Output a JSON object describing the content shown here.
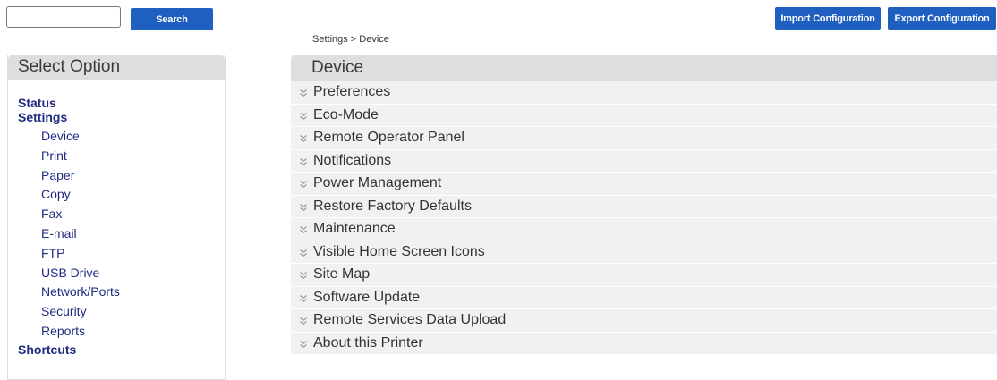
{
  "search": {
    "value": "",
    "placeholder": "",
    "button_label": "Search"
  },
  "header_actions": {
    "import_label": "Import Configuration",
    "export_label": "Export Configuration"
  },
  "breadcrumb": "Settings > Device",
  "sidebar": {
    "title": "Select Option",
    "status_label": "Status",
    "settings_label": "Settings",
    "settings_items": [
      {
        "label": "Device"
      },
      {
        "label": "Print"
      },
      {
        "label": "Paper"
      },
      {
        "label": "Copy"
      },
      {
        "label": "Fax"
      },
      {
        "label": "E-mail"
      },
      {
        "label": "FTP"
      },
      {
        "label": "USB Drive"
      },
      {
        "label": "Network/Ports"
      },
      {
        "label": "Security"
      },
      {
        "label": "Reports"
      }
    ],
    "shortcuts_label": "Shortcuts"
  },
  "main": {
    "title": "Device",
    "sections": [
      {
        "label": "Preferences"
      },
      {
        "label": "Eco-Mode"
      },
      {
        "label": "Remote Operator Panel"
      },
      {
        "label": "Notifications"
      },
      {
        "label": "Power Management"
      },
      {
        "label": "Restore Factory Defaults"
      },
      {
        "label": "Maintenance"
      },
      {
        "label": "Visible Home Screen Icons"
      },
      {
        "label": "Site Map"
      },
      {
        "label": "Software Update"
      },
      {
        "label": "Remote Services Data Upload"
      },
      {
        "label": "About this Printer"
      }
    ],
    "expand_icon": "double-chevron-down-icon"
  },
  "colors": {
    "button_bg": "#1f5fbf",
    "nav_link": "#1f2a80",
    "header_bg": "#dedede",
    "row_bg": "#f1f1f1"
  }
}
